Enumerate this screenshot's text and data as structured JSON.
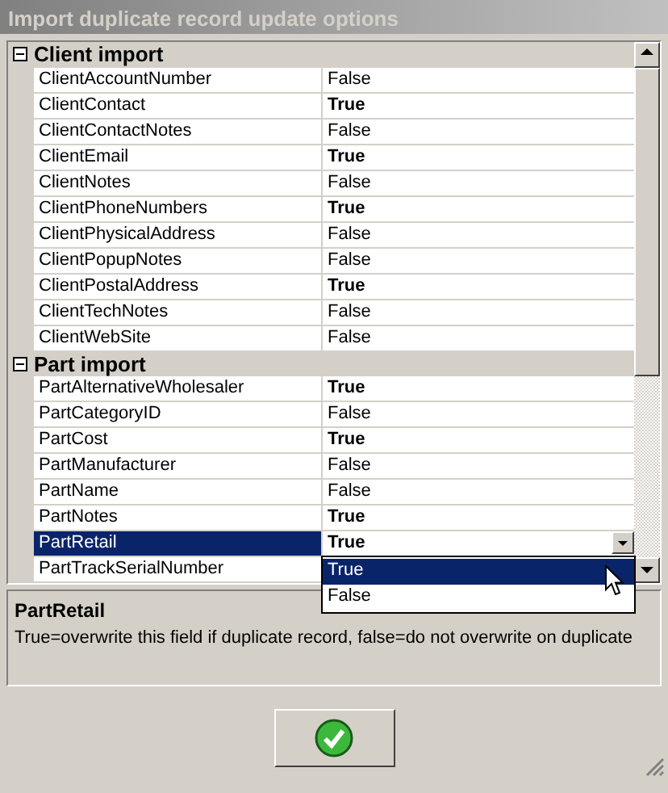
{
  "window": {
    "title": "Import duplicate record update options"
  },
  "categories": [
    {
      "label": "Client import",
      "expanded": true,
      "properties": [
        {
          "name": "ClientAccountNumber",
          "value": "False",
          "modified": false,
          "selected": false
        },
        {
          "name": "ClientContact",
          "value": "True",
          "modified": true,
          "selected": false
        },
        {
          "name": "ClientContactNotes",
          "value": "False",
          "modified": false,
          "selected": false
        },
        {
          "name": "ClientEmail",
          "value": "True",
          "modified": true,
          "selected": false
        },
        {
          "name": "ClientNotes",
          "value": "False",
          "modified": false,
          "selected": false
        },
        {
          "name": "ClientPhoneNumbers",
          "value": "True",
          "modified": true,
          "selected": false
        },
        {
          "name": "ClientPhysicalAddress",
          "value": "False",
          "modified": false,
          "selected": false
        },
        {
          "name": "ClientPopupNotes",
          "value": "False",
          "modified": false,
          "selected": false
        },
        {
          "name": "ClientPostalAddress",
          "value": "True",
          "modified": true,
          "selected": false
        },
        {
          "name": "ClientTechNotes",
          "value": "False",
          "modified": false,
          "selected": false
        },
        {
          "name": "ClientWebSite",
          "value": "False",
          "modified": false,
          "selected": false
        }
      ]
    },
    {
      "label": "Part import",
      "expanded": true,
      "properties": [
        {
          "name": "PartAlternativeWholesaler",
          "value": "True",
          "modified": true,
          "selected": false
        },
        {
          "name": "PartCategoryID",
          "value": "False",
          "modified": false,
          "selected": false
        },
        {
          "name": "PartCost",
          "value": "True",
          "modified": true,
          "selected": false
        },
        {
          "name": "PartManufacturer",
          "value": "False",
          "modified": false,
          "selected": false
        },
        {
          "name": "PartName",
          "value": "False",
          "modified": false,
          "selected": false
        },
        {
          "name": "PartNotes",
          "value": "True",
          "modified": true,
          "selected": false
        },
        {
          "name": "PartRetail",
          "value": "True",
          "modified": true,
          "selected": true
        },
        {
          "name": "PartTrackSerialNumber",
          "selected": false
        }
      ]
    }
  ],
  "dropdown": {
    "options": [
      {
        "label": "True",
        "selected": true
      },
      {
        "label": "False",
        "selected": false
      }
    ]
  },
  "description": {
    "title": "PartRetail",
    "text": "True=overwrite this field if duplicate record, false=do not overwrite on duplicate"
  }
}
